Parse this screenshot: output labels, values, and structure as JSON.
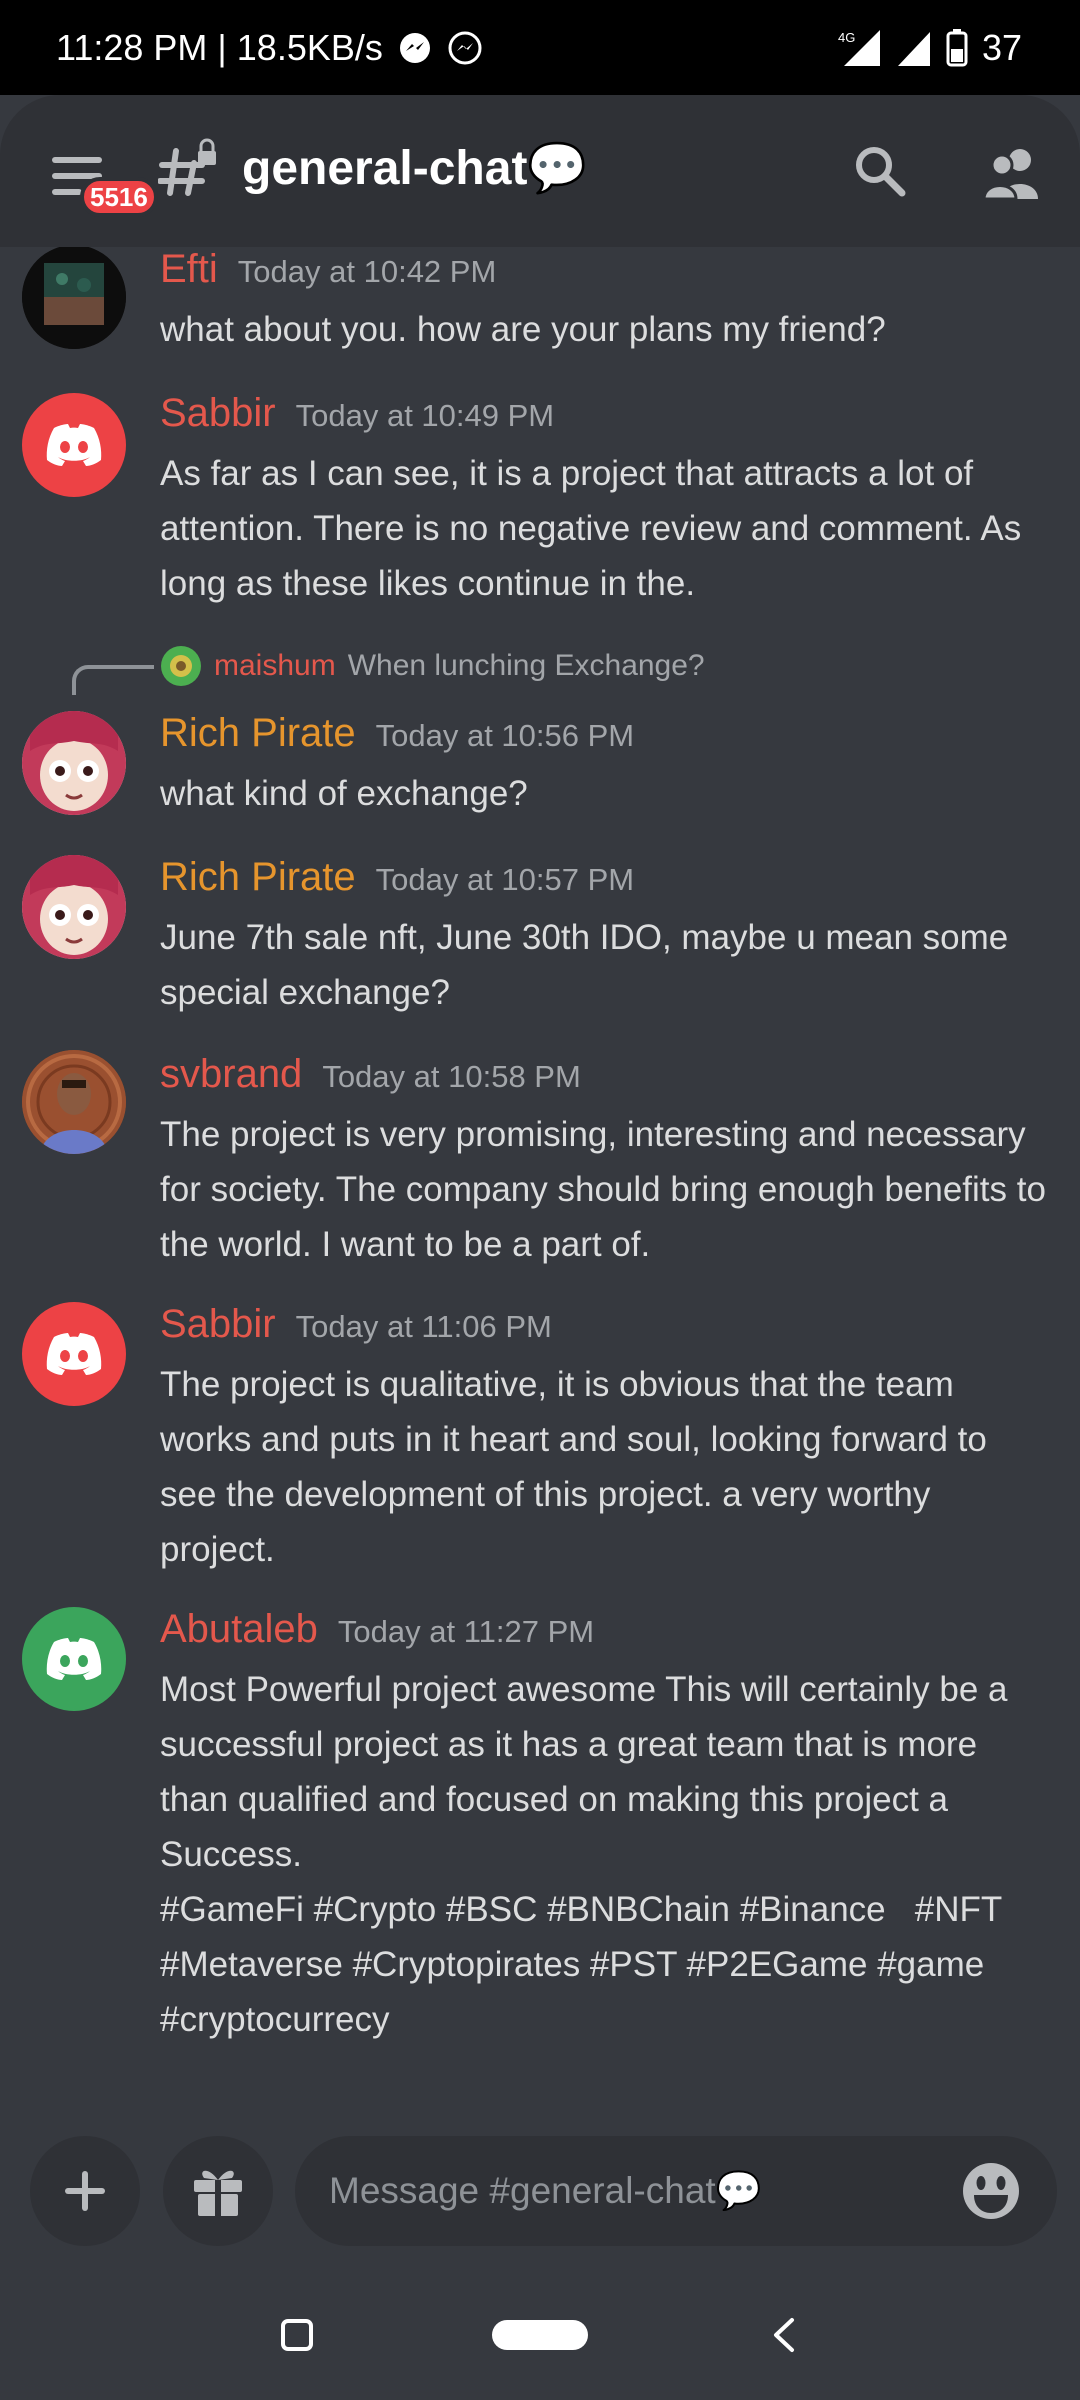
{
  "status_bar": {
    "time_speed": "11:28 PM | 18.5KB/s",
    "network": "4G",
    "battery": "37"
  },
  "header": {
    "badge": "5516",
    "channel_title": "general-chat💬"
  },
  "messages": [
    {
      "author": "Efti",
      "author_color": "#e4584c",
      "time": "Today at 10:42 PM",
      "text": "what about you. how are your plans my friend?"
    },
    {
      "author": "Sabbir",
      "author_color": "#e4584c",
      "time": "Today at 10:49 PM",
      "text": "As far as I can see, it is a project that attracts a lot of attention. There is no negative review and comment. As long as these likes continue in the."
    },
    {
      "reply_author": "maishum",
      "reply_text": "When lunching Exchange?",
      "author": "Rich Pirate",
      "author_color": "#e6952d",
      "time": "Today at 10:56 PM",
      "text": "what kind of exchange?"
    },
    {
      "author": "Rich Pirate",
      "author_color": "#e6952d",
      "time": "Today at 10:57 PM",
      "text": "June 7th sale nft, June 30th IDO, maybe u mean some special exchange?"
    },
    {
      "author": "svbrand",
      "author_color": "#e4584c",
      "time": "Today at 10:58 PM",
      "text": "The project is very promising, interesting and necessary for society. The company should bring enough benefits to the world. I want to be a part of."
    },
    {
      "author": "Sabbir",
      "author_color": "#e4584c",
      "time": "Today at 11:06 PM",
      "text": "The project is qualitative, it is obvious that the team works and puts in it heart and soul, looking forward to see the development of this project. a very worthy project."
    },
    {
      "author": "Abutaleb",
      "author_color": "#e4584c",
      "time": "Today at 11:27 PM",
      "text": "Most Powerful project awesome This will certainly be a successful project as it has a great team that is more than qualified and focused on making this project a Success.",
      "text2": "#GameFi #Crypto #BSC #BNBChain #Binance   #NFT #Metaverse #Cryptopirates #PST #P2EGame #game #cryptocurrecy"
    }
  ],
  "composer": {
    "placeholder": "Message #general-chat💬"
  },
  "colors": {
    "background": "#36393f",
    "header": "#2f3136",
    "discord_red": "#ed4245",
    "discord_green": "#3ba55c"
  }
}
